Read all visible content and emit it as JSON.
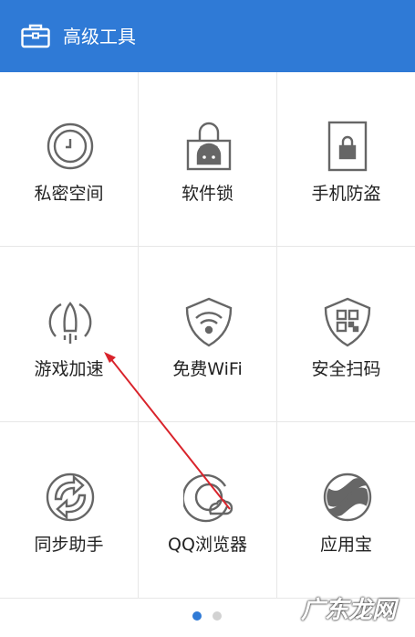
{
  "header": {
    "title": "高级工具",
    "icon": "toolbox-icon",
    "background": "#2f7ad6"
  },
  "tools": [
    {
      "label": "私密空间",
      "icon": "clock-icon"
    },
    {
      "label": "软件锁",
      "icon": "android-lock-icon"
    },
    {
      "label": "手机防盗",
      "icon": "phone-lock-icon"
    },
    {
      "label": "游戏加速",
      "icon": "rocket-icon"
    },
    {
      "label": "免费WiFi",
      "icon": "wifi-shield-icon"
    },
    {
      "label": "安全扫码",
      "icon": "qr-shield-icon"
    },
    {
      "label": "同步助手",
      "icon": "sync-icon"
    },
    {
      "label": "QQ浏览器",
      "icon": "browser-icon"
    },
    {
      "label": "应用宝",
      "icon": "app-store-icon"
    }
  ],
  "pagination": {
    "pages": 2,
    "current": 1
  },
  "watermark": {
    "text": "广东龙网"
  },
  "colors": {
    "accent": "#2f7ad6",
    "annotation_arrow": "#d9232b"
  }
}
